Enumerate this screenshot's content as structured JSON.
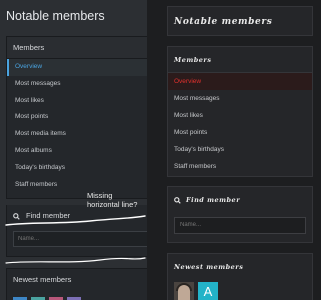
{
  "left": {
    "title": "Notable members",
    "members_block": {
      "heading": "Members",
      "items": [
        {
          "label": "Overview",
          "active": true
        },
        {
          "label": "Most messages"
        },
        {
          "label": "Most likes"
        },
        {
          "label": "Most points"
        },
        {
          "label": "Most media items"
        },
        {
          "label": "Most albums"
        },
        {
          "label": "Today's birthdays"
        },
        {
          "label": "Staff members"
        }
      ]
    },
    "find_block": {
      "heading": "Find member",
      "placeholder": "Name..."
    },
    "newest_block": {
      "heading": "Newest members"
    }
  },
  "annotation": {
    "line1": "Missing",
    "line2": "horizontal line?"
  },
  "right": {
    "title": "Notable members",
    "members_block": {
      "heading": "Members",
      "items": [
        {
          "label": "Overview",
          "active": true
        },
        {
          "label": "Most messages"
        },
        {
          "label": "Most likes"
        },
        {
          "label": "Most points"
        },
        {
          "label": "Today's birthdays"
        },
        {
          "label": "Staff members"
        }
      ]
    },
    "find_block": {
      "heading": "Find member",
      "placeholder": "Name..."
    },
    "newest_block": {
      "heading": "Newest members",
      "avatar_letter": "A"
    }
  },
  "icons": {
    "search": "search-icon"
  },
  "colors": {
    "left_accent": "#4aa3df",
    "right_accent": "#e0302d",
    "annotation_ink": "#ffffff",
    "avatar_letter_bg": "#23b3c8"
  }
}
